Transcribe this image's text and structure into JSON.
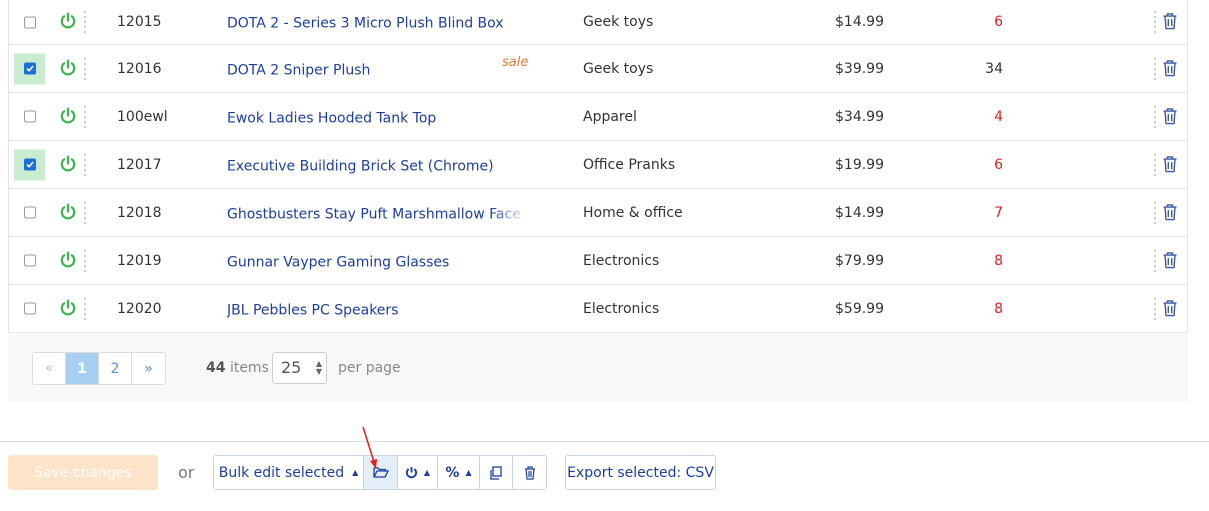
{
  "rows": [
    {
      "sku": "12015",
      "name": "DOTA 2 - Series 3 Micro Plush Blind Box",
      "category": "Geek toys",
      "price": "$14.99",
      "stock": "6",
      "checked": false,
      "sale": "",
      "low": true
    },
    {
      "sku": "12016",
      "name": "DOTA 2 Sniper Plush",
      "category": "Geek toys",
      "price": "$39.99",
      "stock": "34",
      "checked": true,
      "sale": "sale",
      "low": false
    },
    {
      "sku": "100ewl",
      "name": "Ewok Ladies Hooded Tank Top",
      "category": "Apparel",
      "price": "$34.99",
      "stock": "4",
      "checked": false,
      "sale": "",
      "low": true
    },
    {
      "sku": "12017",
      "name": "Executive Building Brick Set (Chrome)",
      "category": "Office Pranks",
      "price": "$19.99",
      "stock": "6",
      "checked": true,
      "sale": "",
      "low": true
    },
    {
      "sku": "12018",
      "name": "Ghostbusters Stay Puft Marshmallow Face Mu",
      "category": "Home & office",
      "price": "$14.99",
      "stock": "7",
      "checked": false,
      "sale": "",
      "low": true
    },
    {
      "sku": "12019",
      "name": "Gunnar Vayper Gaming Glasses",
      "category": "Electronics",
      "price": "$79.99",
      "stock": "8",
      "checked": false,
      "sale": "",
      "low": true
    },
    {
      "sku": "12020",
      "name": "JBL Pebbles PC Speakers",
      "category": "Electronics",
      "price": "$59.99",
      "stock": "8",
      "checked": false,
      "sale": "",
      "low": true
    }
  ],
  "pager": {
    "prev": "«",
    "pages": [
      "1",
      "2"
    ],
    "next": "»",
    "active_page": "1",
    "items_count": "44",
    "items_label": "items",
    "per_page_value": "25",
    "per_page_label": "per page"
  },
  "footer": {
    "save_label": "Save changes",
    "or_label": "or",
    "bulk_label": "Bulk edit selected",
    "export_label": "Export selected: CSV"
  },
  "colors": {
    "link": "#1c3f9e",
    "power_green": "#3cb54a",
    "low_stock_red": "#d82020",
    "sale_orange": "#e07a2c",
    "checked_row_bg": "#c9ecd0",
    "save_disabled_bg": "#fde3c7"
  },
  "icons": {
    "row_toggle": "power-icon",
    "row_delete": "trash-icon",
    "folder": "folder-open-icon",
    "percent": "percent-icon",
    "copy": "copy-icon"
  }
}
